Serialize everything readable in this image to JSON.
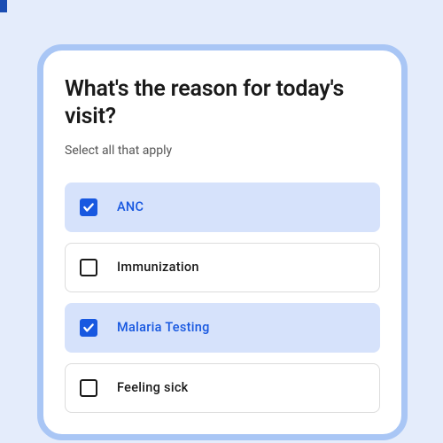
{
  "form": {
    "heading": "What's the reason for today's visit?",
    "subheading": "Select all that apply",
    "options": [
      {
        "label": "ANC",
        "checked": true
      },
      {
        "label": "Immunization",
        "checked": false
      },
      {
        "label": "Malaria Testing",
        "checked": true
      },
      {
        "label": "Feeling sick",
        "checked": false
      }
    ]
  }
}
